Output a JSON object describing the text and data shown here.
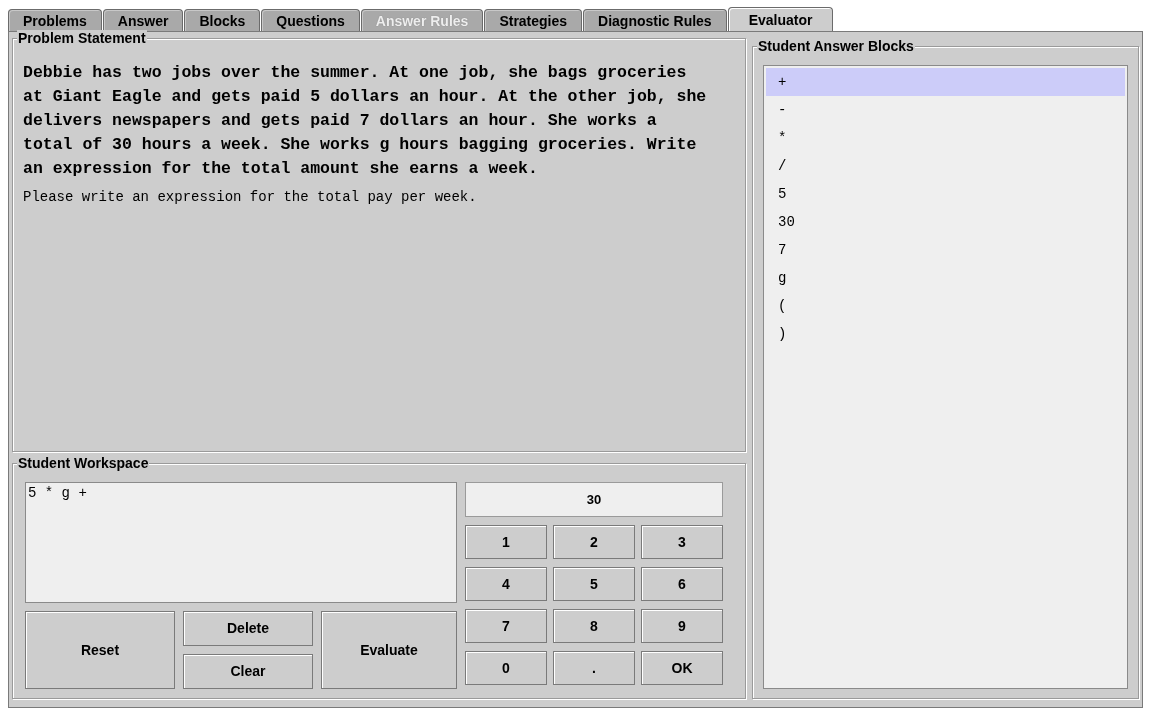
{
  "tabs": [
    {
      "label": "Problems",
      "selected": false,
      "disabled": false
    },
    {
      "label": "Answer",
      "selected": false,
      "disabled": false
    },
    {
      "label": "Blocks",
      "selected": false,
      "disabled": false
    },
    {
      "label": "Questions",
      "selected": false,
      "disabled": false
    },
    {
      "label": "Answer Rules",
      "selected": false,
      "disabled": true
    },
    {
      "label": "Strategies",
      "selected": false,
      "disabled": false
    },
    {
      "label": "Diagnostic Rules",
      "selected": false,
      "disabled": false
    },
    {
      "label": "Evaluator",
      "selected": true,
      "disabled": false
    }
  ],
  "problem_statement": {
    "title": "Problem Statement",
    "question": "Debbie has two jobs over the summer. At one job, she bags groceries at Giant Eagle and gets paid 5 dollars an hour. At the other job, she delivers newspapers and gets paid 7 dollars an hour. She works a total of 30 hours a week. She works g hours bagging groceries. Write an expression for the total amount she earns a week.",
    "prompt": "Please write an expression for the total pay per week."
  },
  "student_workspace": {
    "title": "Student Workspace",
    "expression": "5 * g +",
    "display": "30",
    "buttons": {
      "reset": "Reset",
      "delete": "Delete",
      "clear": "Clear",
      "evaluate": "Evaluate"
    },
    "keypad": [
      "1",
      "2",
      "3",
      "4",
      "5",
      "6",
      "7",
      "8",
      "9",
      "0",
      ".",
      "OK"
    ]
  },
  "answer_blocks": {
    "title": "Student Answer Blocks",
    "items": [
      {
        "label": "+",
        "selected": true
      },
      {
        "label": "-",
        "selected": false
      },
      {
        "label": "*",
        "selected": false
      },
      {
        "label": "/",
        "selected": false
      },
      {
        "label": "5",
        "selected": false
      },
      {
        "label": "30",
        "selected": false
      },
      {
        "label": "7",
        "selected": false
      },
      {
        "label": "g",
        "selected": false
      },
      {
        "label": "(",
        "selected": false
      },
      {
        "label": ")",
        "selected": false
      }
    ]
  }
}
